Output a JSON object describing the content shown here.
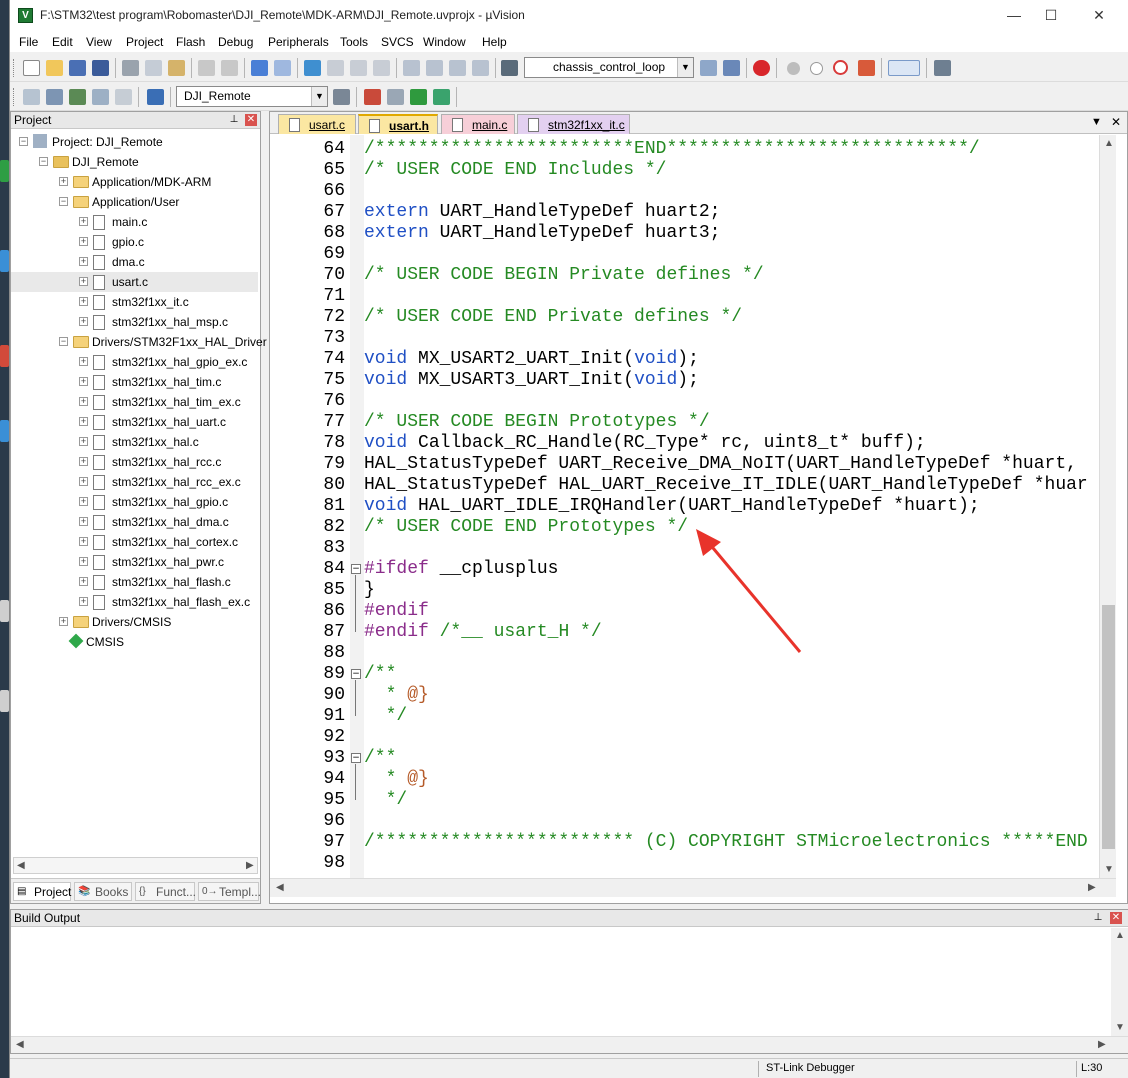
{
  "window": {
    "title": "F:\\STM32\\test program\\Robomaster\\DJI_Remote\\MDK-ARM\\DJI_Remote.uvprojx - µVision",
    "icon_letter": "V",
    "controls": {
      "minimize": "—",
      "maximize": "☐",
      "close": "✕"
    }
  },
  "menu": [
    "File",
    "Edit",
    "View",
    "Project",
    "Flash",
    "Debug",
    "Peripherals",
    "Tools",
    "SVCS",
    "Window",
    "Help"
  ],
  "toolbar": {
    "target_function": "chassis_control_loop",
    "target_name": "DJI_Remote"
  },
  "project_pane": {
    "header": "Project",
    "pin": "📌",
    "close": "✕",
    "tree": [
      {
        "label": "Project: DJI_Remote",
        "level": 0,
        "kind": "project",
        "expand": "−"
      },
      {
        "label": "DJI_Remote",
        "level": 1,
        "kind": "target",
        "expand": "−"
      },
      {
        "label": "Application/MDK-ARM",
        "level": 2,
        "kind": "folder",
        "expand": "+"
      },
      {
        "label": "Application/User",
        "level": 2,
        "kind": "folder",
        "expand": "−"
      },
      {
        "label": "main.c",
        "level": 3,
        "kind": "file",
        "expand": "+"
      },
      {
        "label": "gpio.c",
        "level": 3,
        "kind": "file",
        "expand": "+"
      },
      {
        "label": "dma.c",
        "level": 3,
        "kind": "file",
        "expand": "+"
      },
      {
        "label": "usart.c",
        "level": 3,
        "kind": "file",
        "expand": "+",
        "selected": true
      },
      {
        "label": "stm32f1xx_it.c",
        "level": 3,
        "kind": "file",
        "expand": "+"
      },
      {
        "label": "stm32f1xx_hal_msp.c",
        "level": 3,
        "kind": "file",
        "expand": "+"
      },
      {
        "label": "Drivers/STM32F1xx_HAL_Driver",
        "level": 2,
        "kind": "folder",
        "expand": "−"
      },
      {
        "label": "stm32f1xx_hal_gpio_ex.c",
        "level": 3,
        "kind": "file",
        "expand": "+"
      },
      {
        "label": "stm32f1xx_hal_tim.c",
        "level": 3,
        "kind": "file",
        "expand": "+"
      },
      {
        "label": "stm32f1xx_hal_tim_ex.c",
        "level": 3,
        "kind": "file",
        "expand": "+"
      },
      {
        "label": "stm32f1xx_hal_uart.c",
        "level": 3,
        "kind": "file",
        "expand": "+"
      },
      {
        "label": "stm32f1xx_hal.c",
        "level": 3,
        "kind": "file",
        "expand": "+"
      },
      {
        "label": "stm32f1xx_hal_rcc.c",
        "level": 3,
        "kind": "file",
        "expand": "+"
      },
      {
        "label": "stm32f1xx_hal_rcc_ex.c",
        "level": 3,
        "kind": "file",
        "expand": "+"
      },
      {
        "label": "stm32f1xx_hal_gpio.c",
        "level": 3,
        "kind": "file",
        "expand": "+"
      },
      {
        "label": "stm32f1xx_hal_dma.c",
        "level": 3,
        "kind": "file",
        "expand": "+"
      },
      {
        "label": "stm32f1xx_hal_cortex.c",
        "level": 3,
        "kind": "file",
        "expand": "+"
      },
      {
        "label": "stm32f1xx_hal_pwr.c",
        "level": 3,
        "kind": "file",
        "expand": "+"
      },
      {
        "label": "stm32f1xx_hal_flash.c",
        "level": 3,
        "kind": "file",
        "expand": "+"
      },
      {
        "label": "stm32f1xx_hal_flash_ex.c",
        "level": 3,
        "kind": "file",
        "expand": "+"
      },
      {
        "label": "Drivers/CMSIS",
        "level": 2,
        "kind": "folder",
        "expand": "+"
      },
      {
        "label": "CMSIS",
        "level": 2,
        "kind": "component",
        "expand": ""
      }
    ],
    "tabs": [
      {
        "label": "Project",
        "icon": "▤",
        "active": true
      },
      {
        "label": "Books",
        "icon": "📚",
        "active": false
      },
      {
        "label": "Funct...",
        "icon": "{}",
        "active": false
      },
      {
        "label": "Templ...",
        "icon": "0→",
        "active": false
      }
    ]
  },
  "editor": {
    "tabs": [
      {
        "label": "usart.c",
        "color": "#fbe7a2",
        "active": false
      },
      {
        "label": "usart.h",
        "color": "#fbe7a2",
        "active": true
      },
      {
        "label": "main.c",
        "color": "#f7cfd8",
        "active": false
      },
      {
        "label": "stm32f1xx_it.c",
        "color": "#e3d0f0",
        "active": false
      }
    ],
    "tab_menu_glyph": "▼",
    "tab_close_glyph": "✕",
    "lines": [
      {
        "n": "64",
        "segs": [
          [
            "c",
            "/************************END****************************/"
          ]
        ]
      },
      {
        "n": "65",
        "segs": [
          [
            "c",
            "/* USER CODE END Includes */"
          ]
        ]
      },
      {
        "n": "66",
        "segs": []
      },
      {
        "n": "67",
        "segs": [
          [
            "k",
            "extern"
          ],
          [
            "t",
            " UART_HandleTypeDef huart2;"
          ]
        ]
      },
      {
        "n": "68",
        "segs": [
          [
            "k",
            "extern"
          ],
          [
            "t",
            " UART_HandleTypeDef huart3;"
          ]
        ]
      },
      {
        "n": "69",
        "segs": []
      },
      {
        "n": "70",
        "segs": [
          [
            "c",
            "/* USER CODE BEGIN Private defines */"
          ]
        ]
      },
      {
        "n": "71",
        "segs": []
      },
      {
        "n": "72",
        "segs": [
          [
            "c",
            "/* USER CODE END Private defines */"
          ]
        ]
      },
      {
        "n": "73",
        "segs": []
      },
      {
        "n": "74",
        "segs": [
          [
            "k",
            "void"
          ],
          [
            "t",
            " MX_USART2_UART_Init("
          ],
          [
            "k",
            "void"
          ],
          [
            "t",
            ");"
          ]
        ]
      },
      {
        "n": "75",
        "segs": [
          [
            "k",
            "void"
          ],
          [
            "t",
            " MX_USART3_UART_Init("
          ],
          [
            "k",
            "void"
          ],
          [
            "t",
            ");"
          ]
        ]
      },
      {
        "n": "76",
        "segs": []
      },
      {
        "n": "77",
        "segs": [
          [
            "c",
            "/* USER CODE BEGIN Prototypes */"
          ]
        ]
      },
      {
        "n": "78",
        "segs": [
          [
            "k",
            "void"
          ],
          [
            "t",
            " Callback_RC_Handle(RC_Type* rc, uint8_t* buff);"
          ]
        ]
      },
      {
        "n": "79",
        "segs": [
          [
            "t",
            "HAL_StatusTypeDef UART_Receive_DMA_NoIT(UART_HandleTypeDef *huart,"
          ]
        ]
      },
      {
        "n": "80",
        "segs": [
          [
            "t",
            "HAL_StatusTypeDef HAL_UART_Receive_IT_IDLE(UART_HandleTypeDef *huar"
          ]
        ]
      },
      {
        "n": "81",
        "segs": [
          [
            "k",
            "void"
          ],
          [
            "t",
            " HAL_UART_IDLE_IRQHandler(UART_HandleTypeDef *huart);"
          ]
        ]
      },
      {
        "n": "82",
        "segs": [
          [
            "c",
            "/* USER CODE END Prototypes */"
          ]
        ]
      },
      {
        "n": "83",
        "segs": []
      },
      {
        "n": "84",
        "fold": "−",
        "segs": [
          [
            "p",
            "#ifdef"
          ],
          [
            "t",
            " __cplusplus"
          ]
        ]
      },
      {
        "n": "85",
        "segs": [
          [
            "t",
            "}"
          ]
        ]
      },
      {
        "n": "86",
        "segs": [
          [
            "p",
            "#endif"
          ]
        ]
      },
      {
        "n": "87",
        "segs": [
          [
            "p",
            "#endif"
          ],
          [
            "t",
            " "
          ],
          [
            "c",
            "/*__ usart_H */"
          ]
        ]
      },
      {
        "n": "88",
        "segs": []
      },
      {
        "n": "89",
        "fold": "−",
        "segs": [
          [
            "c",
            "/**"
          ]
        ]
      },
      {
        "n": "90",
        "segs": [
          [
            "c",
            "  * "
          ],
          [
            "d",
            "@}"
          ]
        ]
      },
      {
        "n": "91",
        "segs": [
          [
            "c",
            "  */"
          ]
        ]
      },
      {
        "n": "92",
        "segs": []
      },
      {
        "n": "93",
        "fold": "−",
        "segs": [
          [
            "c",
            "/**"
          ]
        ]
      },
      {
        "n": "94",
        "segs": [
          [
            "c",
            "  * "
          ],
          [
            "d",
            "@}"
          ]
        ]
      },
      {
        "n": "95",
        "segs": [
          [
            "c",
            "  */"
          ]
        ]
      },
      {
        "n": "96",
        "segs": []
      },
      {
        "n": "97",
        "segs": [
          [
            "c",
            "/************************ (C) COPYRIGHT STMicroelectronics *****END"
          ]
        ]
      },
      {
        "n": "98",
        "segs": []
      }
    ]
  },
  "build_output": {
    "header": "Build Output",
    "pin": "📌",
    "close": "✕"
  },
  "status": {
    "debugger": "ST-Link Debugger",
    "position": "L:30"
  },
  "colors": {
    "comment": "#258a23",
    "keyword": "#1f4fc4",
    "preprocessor": "#8a2c8a",
    "doc_tag": "#b55a28",
    "annotation_arrow": "#e8332b"
  }
}
